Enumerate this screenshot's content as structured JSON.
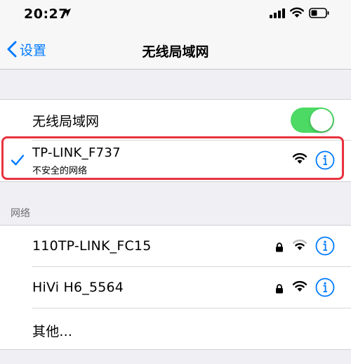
{
  "status_bar": {
    "time": "20:27",
    "icons": [
      "location-arrow-icon",
      "cellular-signal-icon",
      "wifi-icon",
      "battery-icon"
    ]
  },
  "nav": {
    "back_label": "设置",
    "title": "无线局域网"
  },
  "wlan_toggle": {
    "label": "无线局域网",
    "on": true,
    "color": "#4cd964"
  },
  "connected_network": {
    "name": "TP-LINK_F737",
    "subtitle": "不安全的网络",
    "highlight_color": "#e8333f"
  },
  "networks_section": {
    "header": "网络",
    "items": [
      {
        "name": "110TP-LINK_FC15",
        "locked": true
      },
      {
        "name": "HiVi H6_5564",
        "locked": true
      },
      {
        "name": "其他..."
      }
    ]
  },
  "accent_color": "#007aff"
}
